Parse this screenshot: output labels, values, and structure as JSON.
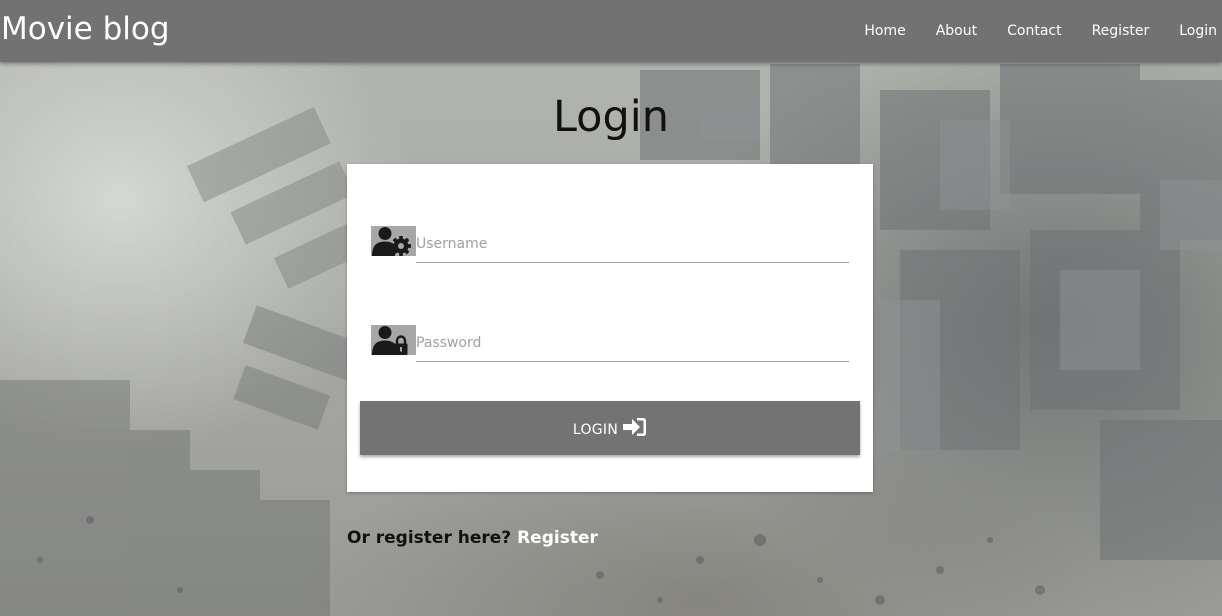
{
  "navbar": {
    "brand": "Movie blog",
    "links": [
      "Home",
      "About",
      "Contact",
      "Register",
      "Login"
    ]
  },
  "page_title": "Login",
  "form": {
    "username": {
      "placeholder": "Username",
      "value": "",
      "icon": "user-cog-icon"
    },
    "password": {
      "placeholder": "Password",
      "value": "",
      "icon": "user-lock-icon"
    },
    "submit": {
      "label": "LOGIN",
      "icon": "sign-in-icon"
    }
  },
  "register_prompt": {
    "text": "Or register here?",
    "link": "Register"
  },
  "colors": {
    "navbar": "#727272",
    "button": "#737373",
    "card": "#ffffff",
    "icon_background": "#a7a7a7"
  }
}
